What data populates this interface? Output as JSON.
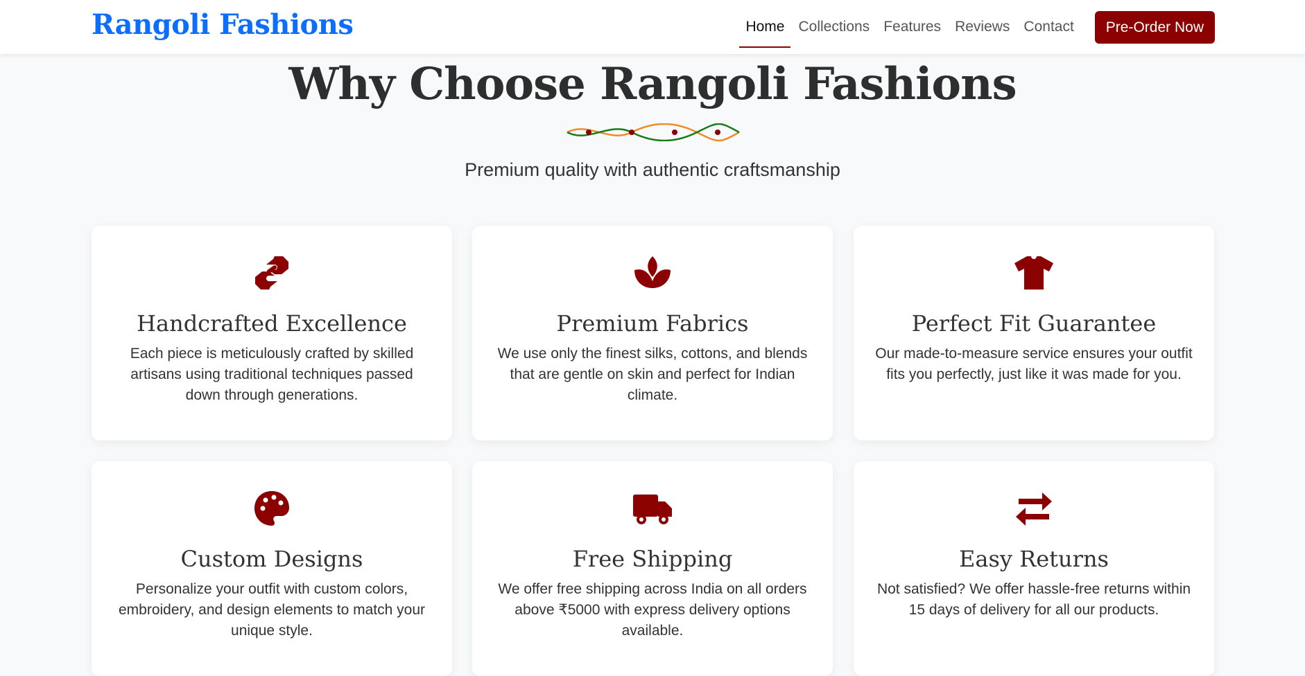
{
  "navbar": {
    "brand": "Rangoli Fashions",
    "links": [
      "Home",
      "Collections",
      "Features",
      "Reviews",
      "Contact"
    ],
    "active_link": "Home",
    "cta_label": "Pre-Order Now"
  },
  "section": {
    "title": "Why Choose Rangoli Fashions",
    "subtitle": "Premium quality with authentic craftsmanship"
  },
  "features": [
    {
      "icon": "handshake-icon",
      "title": "Handcrafted Excellence",
      "text": "Each piece is meticulously crafted by skilled artisans using traditional techniques passed down through generations."
    },
    {
      "icon": "lotus-icon",
      "title": "Premium Fabrics",
      "text": "We use only the finest silks, cottons, and blends that are gentle on skin and perfect for Indian climate."
    },
    {
      "icon": "tshirt-icon",
      "title": "Perfect Fit Guarantee",
      "text": "Our made-to-measure service ensures your outfit fits you perfectly, just like it was made for you."
    },
    {
      "icon": "palette-icon",
      "title": "Custom Designs",
      "text": "Personalize your outfit with custom colors, embroidery, and design elements to match your unique style."
    },
    {
      "icon": "truck-icon",
      "title": "Free Shipping",
      "text": "We offer free shipping across India on all orders above ₹5000 with express delivery options available."
    },
    {
      "icon": "exchange-arrows-icon",
      "title": "Easy Returns",
      "text": "Not satisfied? We offer hassle-free returns within 15 days of delivery for all our products."
    }
  ],
  "colors": {
    "brand": "#0d6efd",
    "accent": "#8b0000",
    "divider_green": "#1a7a1a",
    "divider_orange": "#f08a24"
  }
}
